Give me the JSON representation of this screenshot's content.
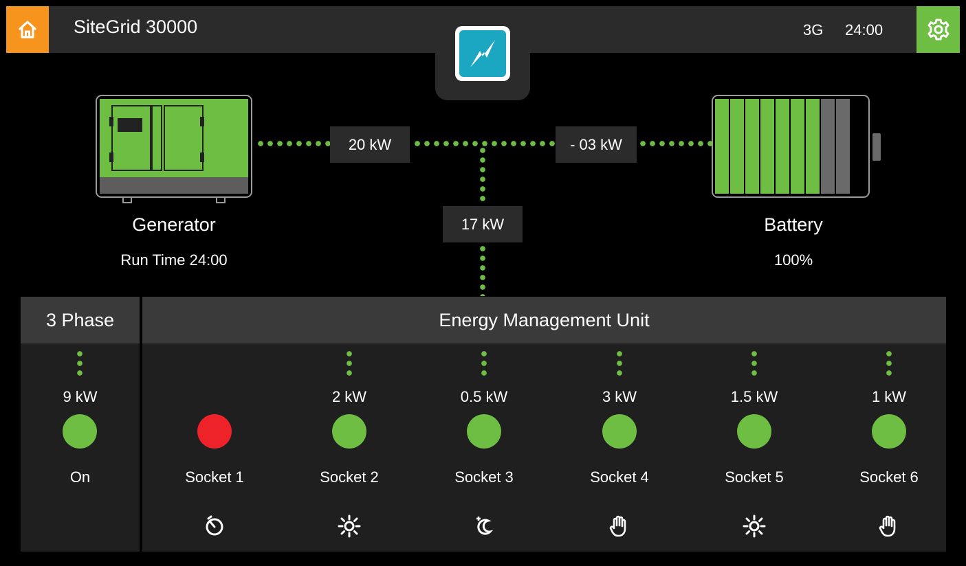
{
  "header": {
    "title": "SiteGrid 30000",
    "network": "3G",
    "time": "24:00"
  },
  "icons": {
    "home": "home-icon",
    "settings": "gear-icon",
    "logo": "lightning-bolt-icon",
    "generator": "generator-icon",
    "battery": "battery-icon"
  },
  "colors": {
    "home_button": "#f7941d",
    "settings_button": "#6fbe44",
    "accent_green": "#6fbe44",
    "alert_red": "#ee2229",
    "logo_blue": "#1ba6c1"
  },
  "flow": {
    "generator_power": "20 kW",
    "battery_power": "- 03 kW",
    "load_power": "17 kW"
  },
  "generator": {
    "label": "Generator",
    "run_time": "Run Time 24:00"
  },
  "battery": {
    "label": "Battery",
    "charge": "100%",
    "charge_fraction": 1.0
  },
  "phase": {
    "title": "3 Phase",
    "power": "9 kW",
    "status": "On",
    "status_color": "#6fbe44"
  },
  "emu": {
    "title": "Energy Management Unit",
    "sockets": [
      {
        "label": "Socket 1",
        "power": "",
        "status_color": "#ee2229",
        "mode_icon": "timer-icon"
      },
      {
        "label": "Socket 2",
        "power": "2 kW",
        "status_color": "#6fbe44",
        "mode_icon": "sun-icon"
      },
      {
        "label": "Socket 3",
        "power": "0.5 kW",
        "status_color": "#6fbe44",
        "mode_icon": "moon-icon"
      },
      {
        "label": "Socket 4",
        "power": "3 kW",
        "status_color": "#6fbe44",
        "mode_icon": "hand-icon"
      },
      {
        "label": "Socket 5",
        "power": "1.5 kW",
        "status_color": "#6fbe44",
        "mode_icon": "sun-icon"
      },
      {
        "label": "Socket 6",
        "power": "1 kW",
        "status_color": "#6fbe44",
        "mode_icon": "hand-icon"
      }
    ]
  }
}
